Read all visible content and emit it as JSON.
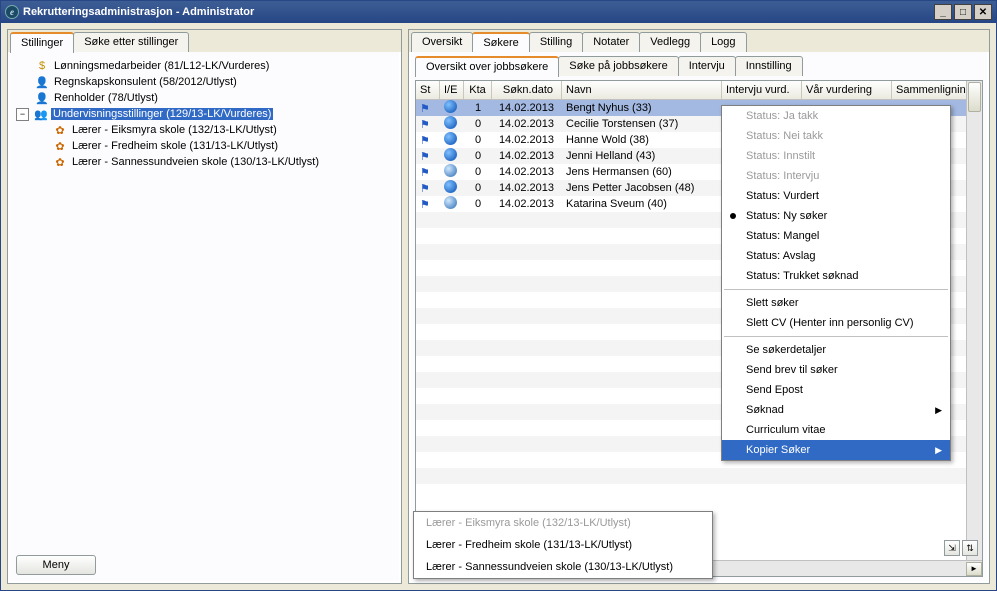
{
  "window": {
    "title": "Rekrutteringsadministrasjon - Administrator"
  },
  "left_tabs": [
    {
      "label": "Stillinger",
      "active": true
    },
    {
      "label": "Søke etter stillinger",
      "active": false
    }
  ],
  "tree": [
    {
      "level": 0,
      "toggle": "",
      "icon": "money",
      "label": "Lønningsmedarbeider (81/L12-LK/Vurderes)",
      "selected": false
    },
    {
      "level": 0,
      "toggle": "",
      "icon": "person",
      "label": "Regnskapskonsulent (58/2012/Utlyst)",
      "selected": false
    },
    {
      "level": 0,
      "toggle": "",
      "icon": "person",
      "label": "Renholder (78/Utlyst)",
      "selected": false
    },
    {
      "level": 0,
      "toggle": "-",
      "icon": "people",
      "label": "Undervisningsstillinger (129/13-LK/Vurderes)",
      "selected": true
    },
    {
      "level": 1,
      "toggle": "",
      "icon": "leaf",
      "label": "Lærer - Eiksmyra skole (132/13-LK/Utlyst)",
      "selected": false
    },
    {
      "level": 1,
      "toggle": "",
      "icon": "leaf",
      "label": "Lærer - Fredheim skole (131/13-LK/Utlyst)",
      "selected": false
    },
    {
      "level": 1,
      "toggle": "",
      "icon": "leaf",
      "label": "Lærer - Sannessundveien skole (130/13-LK/Utlyst)",
      "selected": false
    }
  ],
  "meny_label": "Meny",
  "right_tabs": [
    {
      "label": "Oversikt",
      "active": false
    },
    {
      "label": "Søkere",
      "active": true
    },
    {
      "label": "Stilling",
      "active": false
    },
    {
      "label": "Notater",
      "active": false
    },
    {
      "label": "Vedlegg",
      "active": false
    },
    {
      "label": "Logg",
      "active": false
    }
  ],
  "sub_tabs": [
    {
      "label": "Oversikt over jobbsøkere",
      "active": true
    },
    {
      "label": "Søke på jobbsøkere",
      "active": false
    },
    {
      "label": "Intervju",
      "active": false
    },
    {
      "label": "Innstilling",
      "active": false
    }
  ],
  "columns": {
    "st": "St",
    "ie": "I/E",
    "kta": "Kta",
    "dato": "Søkn.dato",
    "navn": "Navn",
    "intervju": "Intervju vurd.",
    "vurdering": "Vår vurdering",
    "sammen": "Sammenligning"
  },
  "rows": [
    {
      "kta": "1",
      "dato": "14.02.2013",
      "navn": "Bengt Nyhus (33)",
      "globe": "solid",
      "selected": true
    },
    {
      "kta": "0",
      "dato": "14.02.2013",
      "navn": "Cecilie Torstensen (37)",
      "globe": "solid",
      "selected": false
    },
    {
      "kta": "0",
      "dato": "14.02.2013",
      "navn": "Hanne Wold (38)",
      "globe": "solid",
      "selected": false
    },
    {
      "kta": "0",
      "dato": "14.02.2013",
      "navn": "Jenni Helland (43)",
      "globe": "solid",
      "selected": false
    },
    {
      "kta": "0",
      "dato": "14.02.2013",
      "navn": "Jens Hermansen (60)",
      "globe": "grid",
      "selected": false
    },
    {
      "kta": "0",
      "dato": "14.02.2013",
      "navn": "Jens Petter Jacobsen (48)",
      "globe": "solid",
      "selected": false
    },
    {
      "kta": "0",
      "dato": "14.02.2013",
      "navn": "Katarina Sveum (40)",
      "globe": "grid",
      "selected": false
    }
  ],
  "context_menu": [
    {
      "label": "Status: Ja takk",
      "disabled": true
    },
    {
      "label": "Status: Nei takk",
      "disabled": true
    },
    {
      "label": "Status: Innstilt",
      "disabled": true
    },
    {
      "label": "Status: Intervju",
      "disabled": true
    },
    {
      "label": "Status: Vurdert",
      "disabled": false
    },
    {
      "label": "Status: Ny søker",
      "disabled": false,
      "bullet": true
    },
    {
      "label": "Status: Mangel",
      "disabled": false
    },
    {
      "label": "Status: Avslag",
      "disabled": false
    },
    {
      "label": "Status: Trukket søknad",
      "disabled": false
    },
    {
      "sep": true
    },
    {
      "label": "Slett søker",
      "disabled": false
    },
    {
      "label": "Slett CV (Henter inn personlig CV)",
      "disabled": false
    },
    {
      "sep": true
    },
    {
      "label": "Se søkerdetaljer",
      "disabled": false
    },
    {
      "label": "Send brev til søker",
      "disabled": false
    },
    {
      "label": "Send Epost",
      "disabled": false
    },
    {
      "label": "Søknad",
      "disabled": false,
      "submenu": true
    },
    {
      "label": "Curriculum vitae",
      "disabled": false
    },
    {
      "label": "Kopier Søker",
      "disabled": false,
      "submenu": true,
      "highlight": true
    }
  ],
  "kopier_submenu": [
    {
      "label": "Lærer - Eiksmyra skole (132/13-LK/Utlyst)",
      "disabled": true
    },
    {
      "label": "Lærer - Fredheim skole (131/13-LK/Utlyst)",
      "disabled": false
    },
    {
      "label": "Lærer - Sannessundveien skole (130/13-LK/Utlyst)",
      "disabled": false
    }
  ]
}
